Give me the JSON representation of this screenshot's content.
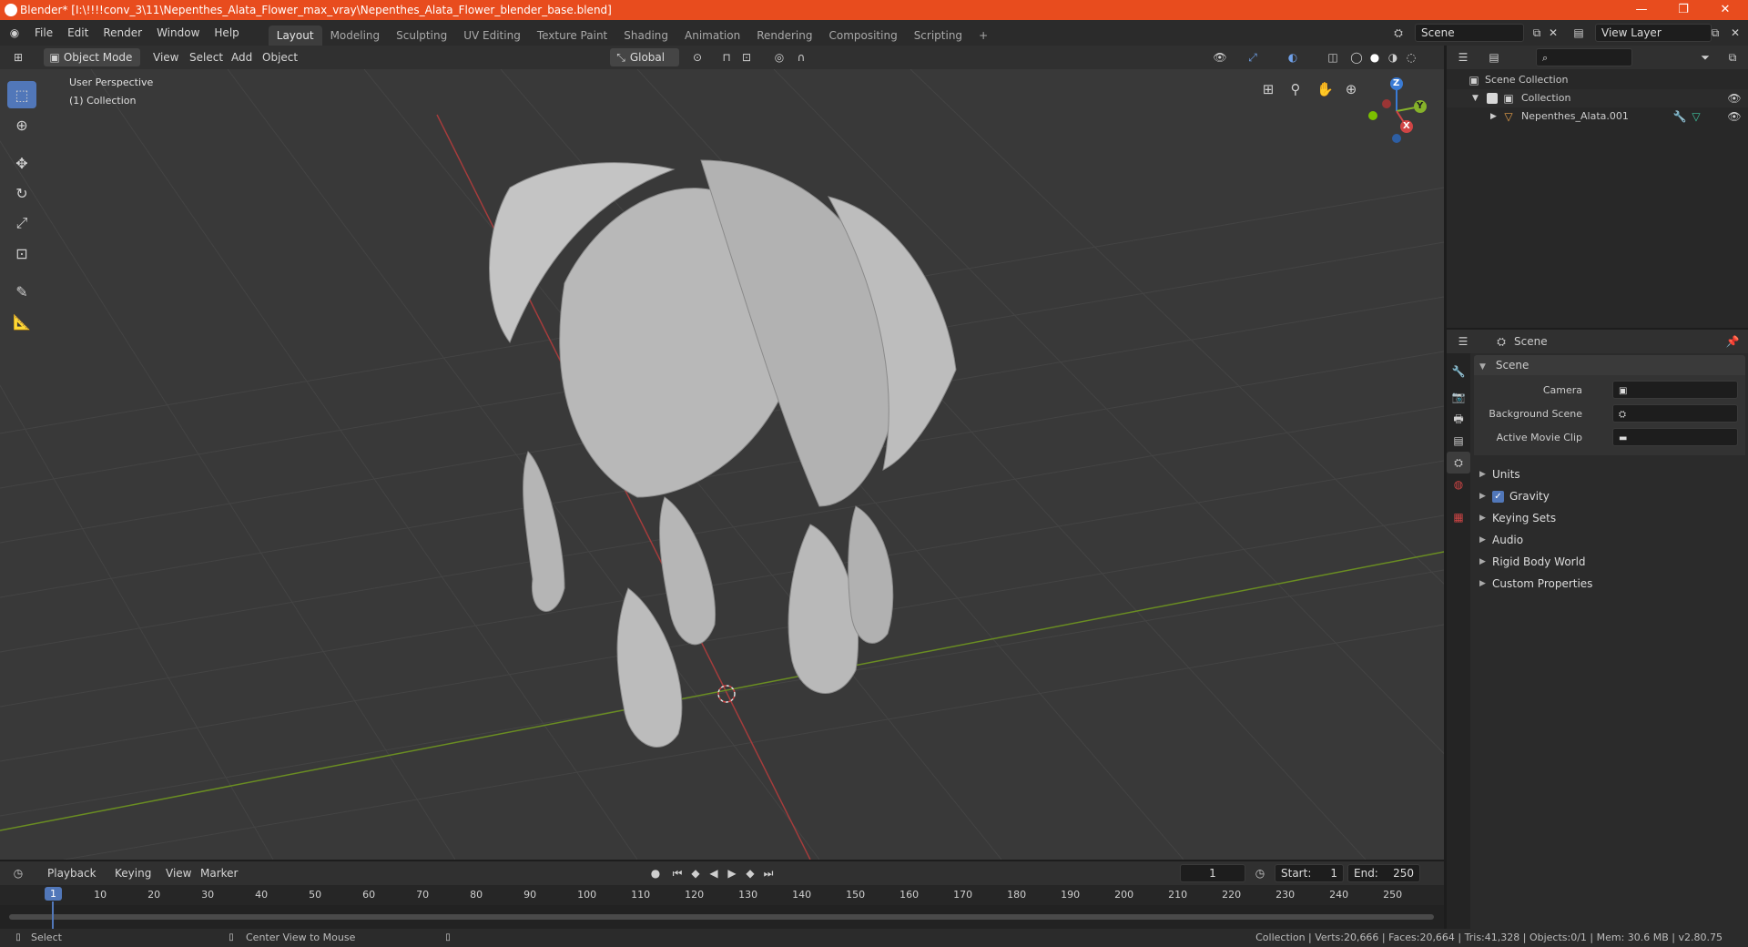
{
  "window": {
    "title": "Blender* [I:\\!!!!conv_3\\11\\Nepenthes_Alata_Flower_max_vray\\Nepenthes_Alata_Flower_blender_base.blend]",
    "minimize": "—",
    "maximize": "❐",
    "close": "✕"
  },
  "menubar": [
    "File",
    "Edit",
    "Render",
    "Window",
    "Help"
  ],
  "workspaces": [
    "Layout",
    "Modeling",
    "Sculpting",
    "UV Editing",
    "Texture Paint",
    "Shading",
    "Animation",
    "Rendering",
    "Compositing",
    "Scripting"
  ],
  "add_workspace": "+",
  "scene_selector": {
    "value": "Scene"
  },
  "view_layer_selector": {
    "value": "View Layer"
  },
  "viewport_header": {
    "mode": "Object Mode",
    "menus": [
      "View",
      "Select",
      "Add",
      "Object"
    ],
    "transform_orientation": "Global"
  },
  "viewport": {
    "perspective_label": "User Perspective",
    "collection_label": "(1) Collection",
    "gizmo": {
      "z": "Z",
      "y": "Y",
      "x": "X"
    }
  },
  "outliner": {
    "root": "Scene Collection",
    "collection": "Collection",
    "object": "Nepenthes_Alata.001"
  },
  "properties": {
    "context": "Scene",
    "panel": "Scene",
    "camera_label": "Camera",
    "background_scene_label": "Background Scene",
    "active_movie_clip_label": "Active Movie Clip",
    "subpanels": [
      "Units",
      "Gravity",
      "Keying Sets",
      "Audio",
      "Rigid Body World",
      "Custom Properties"
    ],
    "gravity_checked": true
  },
  "timeline": {
    "menus": [
      "Playback",
      "Keying",
      "View",
      "Marker"
    ],
    "current_frame": "1",
    "start_label": "Start:",
    "start_value": "1",
    "end_label": "End:",
    "end_value": "250",
    "ticks": [
      "1",
      "10",
      "20",
      "30",
      "40",
      "50",
      "60",
      "70",
      "80",
      "90",
      "100",
      "110",
      "120",
      "130",
      "140",
      "150",
      "160",
      "170",
      "180",
      "190",
      "200",
      "210",
      "220",
      "230",
      "240",
      "250"
    ]
  },
  "statusbar": {
    "left_action": "Select",
    "middle_action": "Center View to Mouse",
    "stats": "Collection | Verts:20,666 | Faces:20,664 | Tris:41,328 | Objects:0/1 | Mem: 30.6 MB | v2.80.75"
  },
  "colors": {
    "titlebar": "#e84c1e",
    "accent": "#5177b9",
    "x_axis": "#d04545",
    "y_axis": "#86b22a",
    "z_axis": "#3a7bd5"
  }
}
